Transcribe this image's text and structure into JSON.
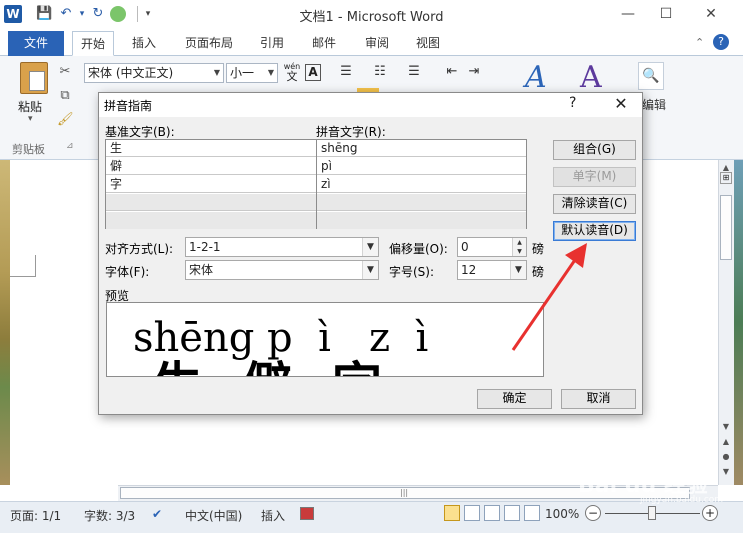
{
  "window": {
    "title": "文档1 - Microsoft Word",
    "minimize": "—",
    "maximize": "☐",
    "close": "✕"
  },
  "quick_access": {
    "app_icon": "W",
    "save": "💾",
    "undo": "↶",
    "undo_arrow": "▾",
    "redo": "↻",
    "customize": "▾"
  },
  "tabs": [
    {
      "label": "文件"
    },
    {
      "label": "开始"
    },
    {
      "label": "插入"
    },
    {
      "label": "页面布局"
    },
    {
      "label": "引用"
    },
    {
      "label": "邮件"
    },
    {
      "label": "审阅"
    },
    {
      "label": "视图"
    }
  ],
  "ribbon": {
    "paste_label": "粘贴",
    "paste_arrow": "▾",
    "clipboard_label": "剪贴板",
    "clipboard_launcher": "⊿",
    "font_name": "宋体 (中文正文)",
    "font_size": "小一",
    "phonetic_guide_glyph": "wén\n文",
    "char_border_glyph": "A",
    "bullets_glyph": "☰",
    "numbering_glyph": "☷",
    "multilevel_glyph": "☰",
    "decrease_indent_glyph": "⇤",
    "increase_indent_glyph": "⇥",
    "styles_glyph_1": "A",
    "styles_glyph_2": "A",
    "find_glyph": "🔍",
    "edit_label": "编辑",
    "help_glyph": "?",
    "collapse_glyph": "⌃"
  },
  "dialog": {
    "title": "拼音指南",
    "help": "?",
    "close": "✕",
    "base_text_label": "基准文字(B):",
    "ruby_text_label": "拼音文字(R):",
    "rows": [
      {
        "base": "生",
        "ruby": "shēng"
      },
      {
        "base": "僻",
        "ruby": "pì"
      },
      {
        "base": "字",
        "ruby": "zì"
      },
      {
        "base": "",
        "ruby": ""
      },
      {
        "base": "",
        "ruby": ""
      }
    ],
    "buttons": {
      "group": "组合(G)",
      "mono": "单字(M)",
      "clear": "清除读音(C)",
      "default": "默认读音(D)",
      "ok": "确定",
      "cancel": "取消"
    },
    "alignment_label": "对齐方式(L):",
    "alignment_value": "1-2-1",
    "offset_label": "偏移量(O):",
    "offset_value": "0",
    "offset_unit": "磅",
    "font_label": "字体(F):",
    "font_value": "宋体",
    "size_label": "字号(S):",
    "size_value": "12",
    "size_unit": "磅",
    "preview_label": "预览",
    "preview_pinyin": "shēng p  ì   z  ì",
    "preview_chars": "生僻字"
  },
  "status": {
    "page": "页面: 1/1",
    "words": "字数: 3/3",
    "language": "中文(中国)",
    "insert": "插入",
    "zoom": "100%",
    "zoom_minus": "−",
    "zoom_plus": "+"
  },
  "watermark": {
    "text": "Bai du 经验",
    "sub": "jingyan.baidu.com"
  },
  "colors": {
    "file_tab": "#2a63b6",
    "annotation_arrow": "#e8312f",
    "focus_border": "#3a7bd5"
  }
}
